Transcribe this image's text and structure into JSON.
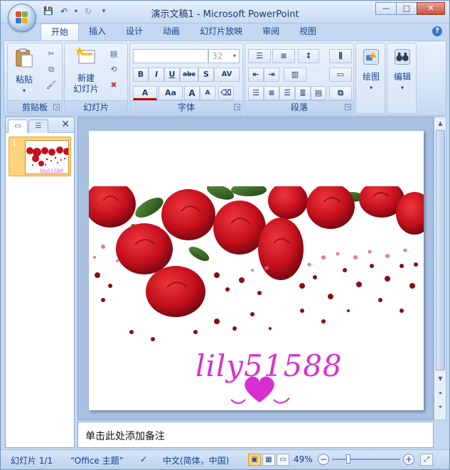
{
  "window": {
    "title": "演示文稿1 - Microsoft PowerPoint",
    "controls": {
      "minimize": "—",
      "maximize": "□",
      "close": "✕"
    }
  },
  "qat": {
    "save": "💾",
    "undo": "↶",
    "redo": "↻",
    "more": "▾"
  },
  "tabs": [
    {
      "label": "开始",
      "active": true
    },
    {
      "label": "插入"
    },
    {
      "label": "设计"
    },
    {
      "label": "动画"
    },
    {
      "label": "幻灯片放映"
    },
    {
      "label": "审阅"
    },
    {
      "label": "视图"
    }
  ],
  "help": "?",
  "ribbon": {
    "clipboard": {
      "label": "剪贴板",
      "paste": "粘贴"
    },
    "slides": {
      "label": "幻灯片",
      "new_slide_line1": "新建",
      "new_slide_line2": "幻灯片"
    },
    "font": {
      "label": "字体",
      "font_name": "",
      "font_size": "32",
      "bold": "B",
      "italic": "I",
      "underline": "U",
      "strike": "abc",
      "shadow": "S",
      "spacing": "AV",
      "color": "A",
      "case": "Aa",
      "grow": "A",
      "shrink": "A"
    },
    "paragraph": {
      "label": "段落"
    },
    "drawing": {
      "label": "绘图"
    },
    "editing": {
      "label": "编辑"
    }
  },
  "leftpane": {
    "slide_number": "1"
  },
  "slide": {
    "text": "lily51588"
  },
  "notes": {
    "placeholder": "单击此处添加备注"
  },
  "status": {
    "slide": "幻灯片 1/1",
    "theme": "“Office 主题”",
    "language": "中文(简体，中国)",
    "zoom": "49%"
  },
  "colors": {
    "accent": "#15428b",
    "ribbon_bg": "#d2e2f6",
    "rose": "#c4101c",
    "text_pink": "#d92fd0"
  }
}
